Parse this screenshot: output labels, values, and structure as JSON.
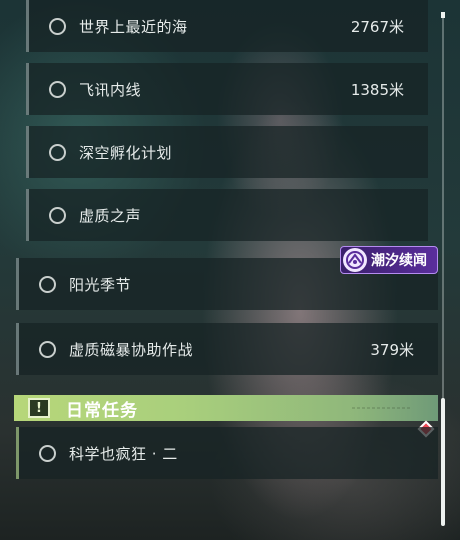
{
  "quests": [
    {
      "title": "世界上最近的海",
      "distance": "2767米"
    },
    {
      "title": "飞讯内线",
      "distance": "1385米"
    },
    {
      "title": "深空孵化计划",
      "distance": ""
    },
    {
      "title": "虚质之声",
      "distance": ""
    },
    {
      "title": "阳光季节",
      "distance": "",
      "tag": "潮汐续闻"
    },
    {
      "title": "虚质磁暴协助作战",
      "distance": "379米"
    }
  ],
  "daily": {
    "header": "日常任务",
    "icon": "exclamation-icon",
    "quests": [
      {
        "title": "科学也疯狂 · 二"
      }
    ]
  },
  "colors": {
    "tag_purple": "#5a2e9c",
    "daily_green": "#b7d77a",
    "marker_red": "#ef4a56"
  },
  "icons": {
    "quest_status": "circle-icon",
    "tag": "tidal-swirl-icon",
    "marker": "diamond-marker-icon"
  }
}
